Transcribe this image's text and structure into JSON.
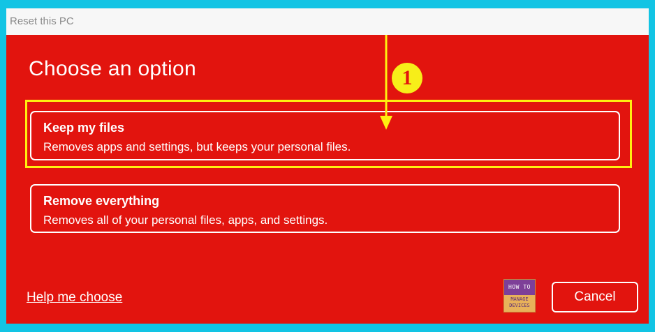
{
  "window": {
    "title": "Reset this PC"
  },
  "main": {
    "heading": "Choose an option",
    "options": [
      {
        "title": "Keep my files",
        "description": "Removes apps and settings, but keeps your personal files."
      },
      {
        "title": "Remove everything",
        "description": "Removes all of your personal files, apps, and settings."
      }
    ]
  },
  "annotation": {
    "step_number": "1"
  },
  "footer": {
    "help_link": "Help me choose",
    "cancel_label": "Cancel",
    "logo_top": "HOW TO",
    "logo_mid": "MANAGE",
    "logo_bot": "DEVICES"
  },
  "colors": {
    "window_bg": "#e2140e",
    "frame_bg": "#12c4e4",
    "highlight": "#ffef10",
    "text": "#ffffff"
  }
}
